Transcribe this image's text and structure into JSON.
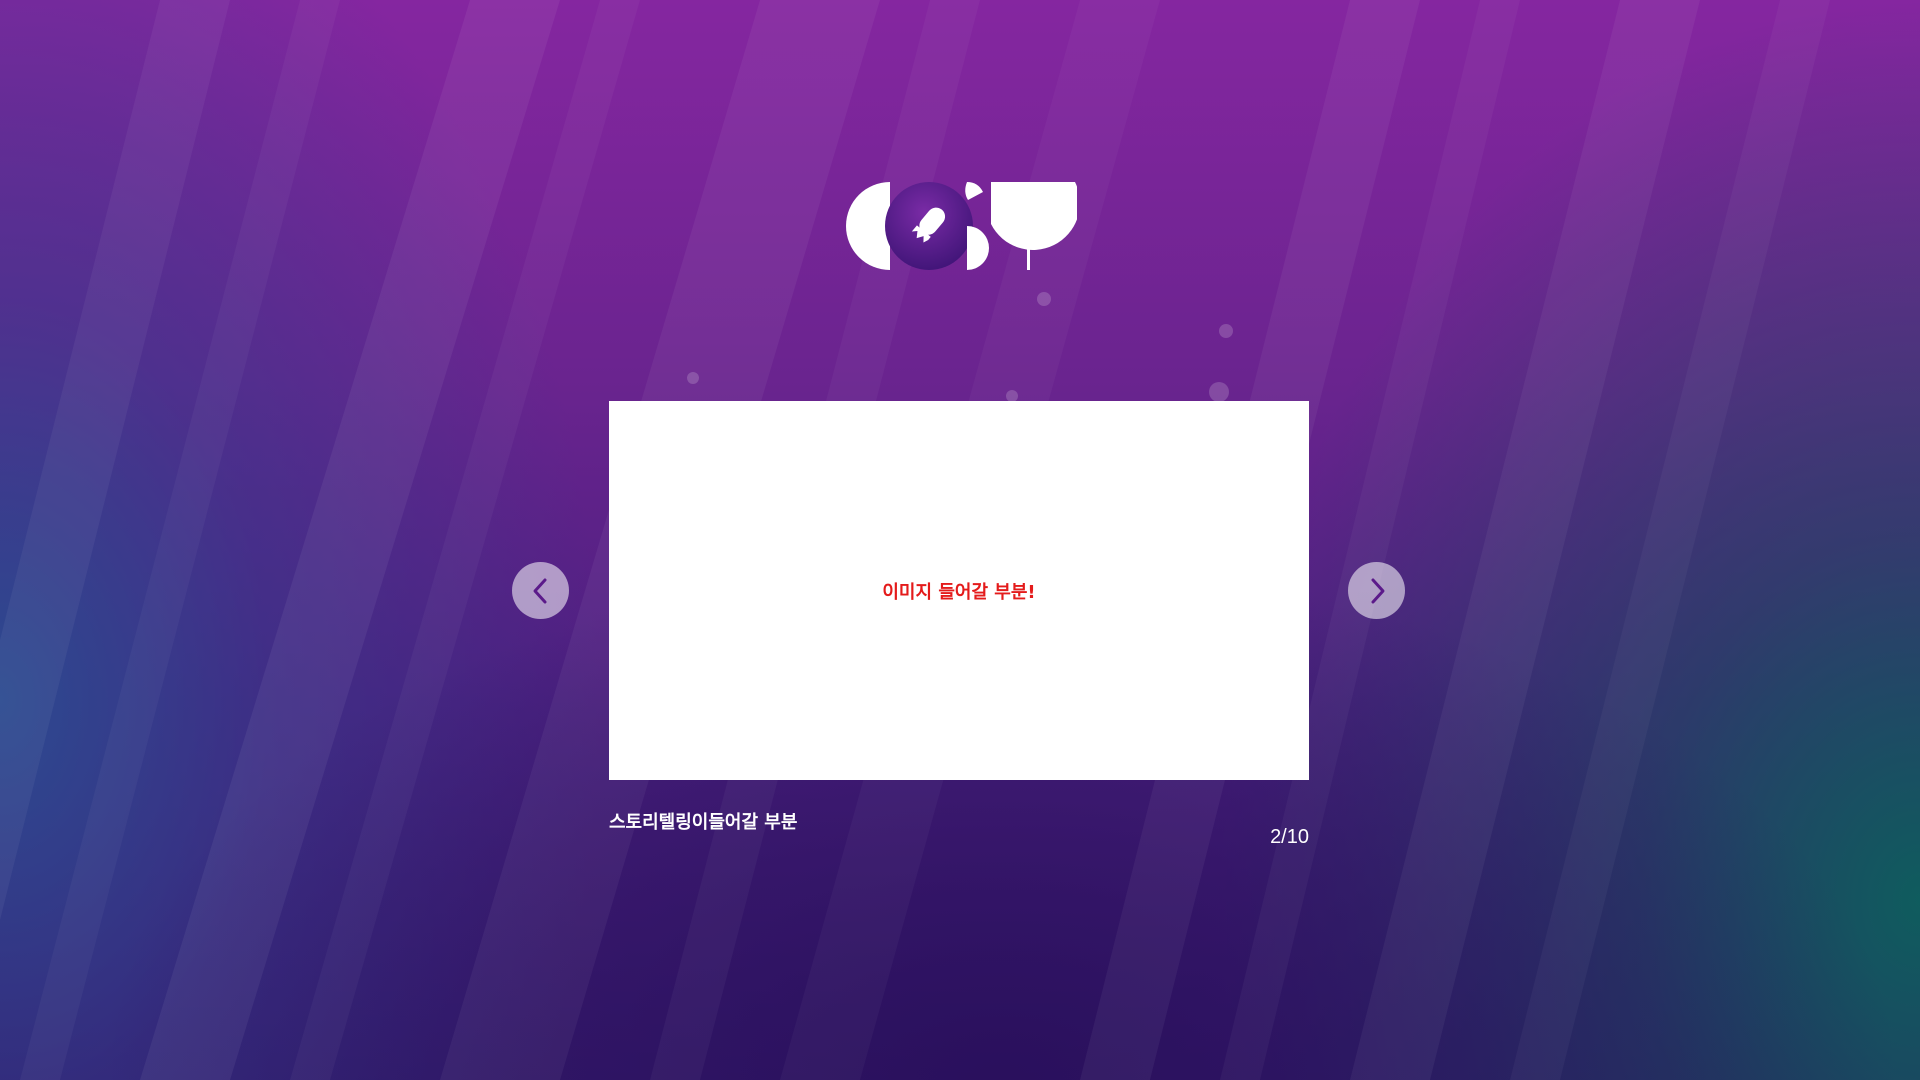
{
  "logo": {
    "alt": "COST"
  },
  "slide": {
    "placeholder_text": "이미지 들어갈 부분!",
    "caption": "스토리텔링이들어갈 부분",
    "counter": "2/10"
  },
  "nav": {
    "prev_icon": "chevron-left-icon",
    "next_icon": "chevron-right-icon"
  },
  "colors": {
    "placeholder_text": "#e41b1b",
    "accent_purple": "#5b1a8a",
    "nav_button_bg": "rgba(255,255,255,0.55)"
  }
}
